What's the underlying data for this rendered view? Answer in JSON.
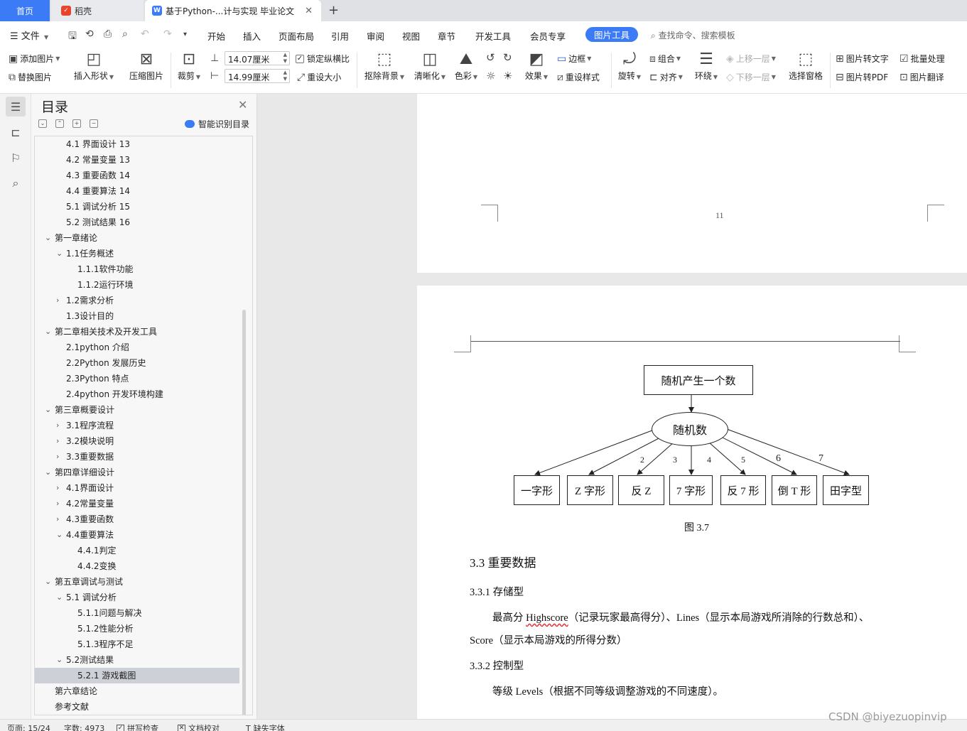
{
  "tabs": {
    "home": "首页",
    "daoke": "稻壳",
    "document": "基于Python-...计与实现 毕业论文"
  },
  "menu": {
    "file": "文件",
    "items": [
      "开始",
      "插入",
      "页面布局",
      "引用",
      "审阅",
      "视图",
      "章节",
      "开发工具",
      "会员专享"
    ],
    "active": "图片工具",
    "search_placeholder": "查找命令、搜索模板"
  },
  "ribbon": {
    "add_picture": "添加图片",
    "replace_picture": "替换图片",
    "insert_shape": "插入形状",
    "compress_picture": "压缩图片",
    "crop": "裁剪",
    "width_value": "14.07厘米",
    "height_value": "14.99厘米",
    "lock_ratio": "锁定纵横比",
    "reset_size": "重设大小",
    "remove_background": "抠除背景",
    "sharpen": "清晰化",
    "color": "色彩",
    "effects": "效果",
    "border": "边框",
    "reset_style": "重设样式",
    "rotate": "旋转",
    "group": "组合",
    "align": "对齐",
    "wrap": "环绕",
    "bring_forward": "上移一层",
    "send_backward": "下移一层",
    "selection_pane": "选择窗格",
    "picture_to_text": "图片转文字",
    "picture_to_pdf": "图片转PDF",
    "batch_process": "批量处理",
    "picture_translate": "图片翻译"
  },
  "toc": {
    "title": "目录",
    "smart_recognize": "智能识别目录",
    "items": [
      {
        "label": "4.1  界面设计  13",
        "level": 2,
        "arrow": ""
      },
      {
        "label": "4.2  常量变量  13",
        "level": 2,
        "arrow": ""
      },
      {
        "label": "4.3  重要函数  14",
        "level": 2,
        "arrow": ""
      },
      {
        "label": "4.4  重要算法  14",
        "level": 2,
        "arrow": ""
      },
      {
        "label": "5.1  调试分析  15",
        "level": 2,
        "arrow": ""
      },
      {
        "label": "5.2  测试结果  16",
        "level": 2,
        "arrow": ""
      },
      {
        "label": "第一章绪论",
        "level": 1,
        "arrow": "down"
      },
      {
        "label": "1.1任务概述",
        "level": 2,
        "arrow": "down"
      },
      {
        "label": "1.1.1软件功能",
        "level": 3,
        "arrow": ""
      },
      {
        "label": "1.1.2运行环境",
        "level": 3,
        "arrow": ""
      },
      {
        "label": "1.2需求分析",
        "level": 2,
        "arrow": "right"
      },
      {
        "label": "1.3设计目的",
        "level": 2,
        "arrow": ""
      },
      {
        "label": "第二章相关技术及开发工具",
        "level": 1,
        "arrow": "down"
      },
      {
        "label": "2.1python 介绍",
        "level": 2,
        "arrow": ""
      },
      {
        "label": "2.2Python  发展历史",
        "level": 2,
        "arrow": ""
      },
      {
        "label": "2.3Python  特点",
        "level": 2,
        "arrow": ""
      },
      {
        "label": "2.4python 开发环境构建",
        "level": 2,
        "arrow": ""
      },
      {
        "label": "第三章概要设计",
        "level": 1,
        "arrow": "down"
      },
      {
        "label": "3.1程序流程",
        "level": 2,
        "arrow": "right"
      },
      {
        "label": "3.2模块说明",
        "level": 2,
        "arrow": "right"
      },
      {
        "label": "3.3重要数据",
        "level": 2,
        "arrow": "right"
      },
      {
        "label": "第四章详细设计",
        "level": 1,
        "arrow": "down"
      },
      {
        "label": "4.1界面设计",
        "level": 2,
        "arrow": "right"
      },
      {
        "label": "4.2常量变量",
        "level": 2,
        "arrow": "right"
      },
      {
        "label": "4.3重要函数",
        "level": 2,
        "arrow": "right"
      },
      {
        "label": "4.4重要算法",
        "level": 2,
        "arrow": "down"
      },
      {
        "label": "4.4.1判定",
        "level": 3,
        "arrow": ""
      },
      {
        "label": "4.4.2变换",
        "level": 3,
        "arrow": ""
      },
      {
        "label": "第五章调试与测试",
        "level": 1,
        "arrow": "down"
      },
      {
        "label": "5.1 调试分析",
        "level": 2,
        "arrow": "down"
      },
      {
        "label": "5.1.1问题与解决",
        "level": 3,
        "arrow": ""
      },
      {
        "label": "5.1.2性能分析",
        "level": 3,
        "arrow": ""
      },
      {
        "label": "5.1.3程序不足",
        "level": 3,
        "arrow": ""
      },
      {
        "label": "5.2测试结果",
        "level": 2,
        "arrow": "down"
      },
      {
        "label": "5.2.1 游戏截图",
        "level": 3,
        "arrow": "",
        "selected": true
      },
      {
        "label": "第六章结论",
        "level": 1,
        "arrow": ""
      },
      {
        "label": "参考文献",
        "level": 1,
        "arrow": ""
      }
    ]
  },
  "document": {
    "page_number": "11",
    "flowchart": {
      "top_box": "随机产生一个数",
      "oval": "随机数",
      "branch_numbers": [
        "2",
        "3",
        "4",
        "5",
        "6",
        "7"
      ],
      "shapes": [
        "一字形",
        "Z 字形",
        "反    Z",
        "7 字形",
        "反 7 形",
        "倒 T 形",
        "田字型"
      ]
    },
    "figure_caption": "图 3.7",
    "section_heading": "3.3  重要数据",
    "sub1_heading": "3.3.1  存储型",
    "para1_line1_a": "最高分 ",
    "para1_line1_b": "Highscore",
    "para1_line1_c": "（记录玩家最高得分）、Lines（显示本局游戏所消除的行数总和）、",
    "para1_line2": "Score（显示本局游戏的所得分数）",
    "sub2_heading": "3.3.2  控制型",
    "para2": "等级 Levels（根据不同等级调整游戏的不同速度）。"
  },
  "status": {
    "page": "页面: 15/24",
    "word_count": "字数: 4973",
    "spell_check": "拼写检查",
    "doc_proof": "文档校对",
    "missing_font": "缺失字体"
  },
  "watermark": "CSDN @biyezuopinvip"
}
